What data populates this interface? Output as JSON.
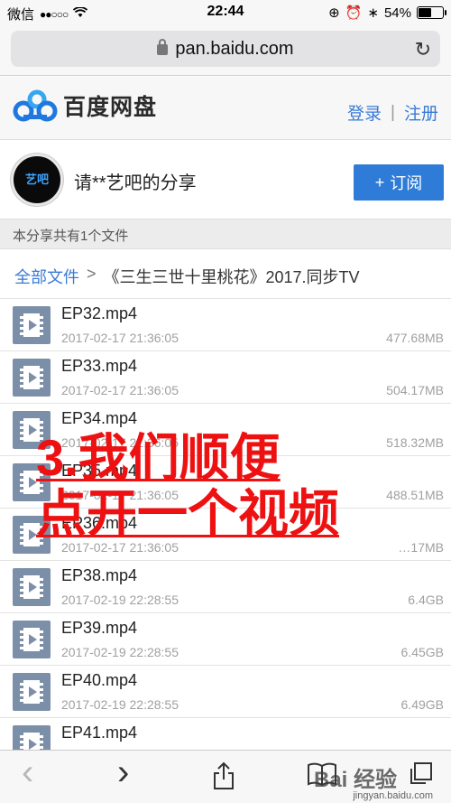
{
  "status": {
    "carrier": "微信",
    "time": "22:44",
    "battery": "54%",
    "battery_fraction": 0.54
  },
  "browser": {
    "url": "pan.baidu.com"
  },
  "app": {
    "logo_text": "百度网盘",
    "login": "登录",
    "separator": "|",
    "register": "注册"
  },
  "share": {
    "avatar_text": "艺吧",
    "title": "请**艺吧的分享",
    "subscribe": "订阅",
    "subscribe_icon": "+"
  },
  "file_count": "本分享共有1个文件",
  "breadcrumb": {
    "root": "全部文件",
    "arrow": ">",
    "current": "《三生三世十里桃花》2017.同步TV"
  },
  "files": [
    {
      "name": "EP32.mp4",
      "date": "2017-02-17 21:36:05",
      "size": "477.68MB"
    },
    {
      "name": "EP33.mp4",
      "date": "2017-02-17 21:36:05",
      "size": "504.17MB"
    },
    {
      "name": "EP34.mp4",
      "date": "2017-02-17 21:36:05",
      "size": "518.32MB"
    },
    {
      "name": "EP35.mp4",
      "date": "2017-02-17 21:36:05",
      "size": "488.51MB"
    },
    {
      "name": "EP36.mp4",
      "date": "2017-02-17 21:36:05",
      "size": "…17MB"
    },
    {
      "name": "EP38.mp4",
      "date": "2017-02-19 22:28:55",
      "size": "6.4GB"
    },
    {
      "name": "EP39.mp4",
      "date": "2017-02-19 22:28:55",
      "size": "6.45GB"
    },
    {
      "name": "EP40.mp4",
      "date": "2017-02-19 22:28:55",
      "size": "6.49GB"
    },
    {
      "name": "EP41.mp4",
      "date": "",
      "size": ""
    }
  ],
  "overlay": {
    "line1": "3.我们顺便",
    "line2": "点开一个视频"
  },
  "toolbar": {
    "back": "‹",
    "forward": "›",
    "share": "⇪",
    "bookmarks": "📖",
    "tabs": "⧉"
  },
  "watermark": {
    "main": "Bai 经验",
    "sub": "jingyan.baidu.com"
  },
  "colors": {
    "accent": "#3a7bd5",
    "button": "#2f7cd8",
    "overlay_red": "#ee1111"
  }
}
